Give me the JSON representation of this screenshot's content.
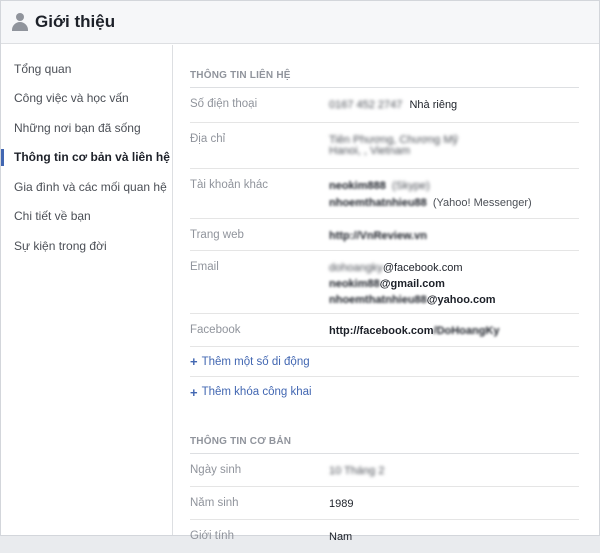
{
  "header": {
    "title": "Giới thiệu"
  },
  "sidebar": {
    "items": [
      {
        "label": "Tổng quan",
        "active": false
      },
      {
        "label": "Công việc và học vấn",
        "active": false
      },
      {
        "label": "Những nơi bạn đã sống",
        "active": false
      },
      {
        "label": "Thông tin cơ bản và liên hệ",
        "active": true
      },
      {
        "label": "Gia đình và các mối quan hệ",
        "active": false
      },
      {
        "label": "Chi tiết về bạn",
        "active": false
      },
      {
        "label": "Sự kiện trong đời",
        "active": false
      }
    ]
  },
  "contact": {
    "section_title": "THÔNG TIN LIÊN HỆ",
    "phone": {
      "label": "Số điện thoại",
      "value_blurred": "0167 452 2747",
      "type": "Nhà riêng"
    },
    "address": {
      "label": "Địa chỉ",
      "line1_blurred": "Tiên Phương, Chương Mỹ",
      "line2_blurred": "Hanoi, , Vietnam"
    },
    "accounts": {
      "label": "Tài khoản khác",
      "skype_blurred": "neokim888",
      "skype_type": "(Skype)",
      "yahoo_blurred": "nhoemthatnhieu88",
      "yahoo_type": "(Yahoo! Messenger)"
    },
    "website": {
      "label": "Trang web",
      "value_blurred": "http://VnReview.vn"
    },
    "email": {
      "label": "Email",
      "e1_user_blurred": "dohoangky",
      "e1_domain": "@facebook.com",
      "e2_user_blurred": "neokim88",
      "e2_domain": "@gmail.com",
      "e3_user_blurred": "nhoemthatnhieu88",
      "e3_domain": "@yahoo.com"
    },
    "facebook": {
      "label": "Facebook",
      "prefix": "http://facebook.com",
      "suffix_blurred": "/DoHoangKy"
    },
    "add_mobile": {
      "plus": "+",
      "label": "Thêm một số di động"
    },
    "add_key": {
      "plus": "+",
      "label": "Thêm khóa công khai"
    }
  },
  "basic": {
    "section_title": "THÔNG TIN CƠ BẢN",
    "birthday": {
      "label": "Ngày sinh",
      "value_blurred": "10 Tháng 2"
    },
    "birth_year": {
      "label": "Năm sinh",
      "value": "1989"
    },
    "gender": {
      "label": "Giới tính",
      "value": "Nam"
    }
  },
  "colors": {
    "link": "#4267b2",
    "muted": "#90949c",
    "accent": "#4267b2"
  }
}
